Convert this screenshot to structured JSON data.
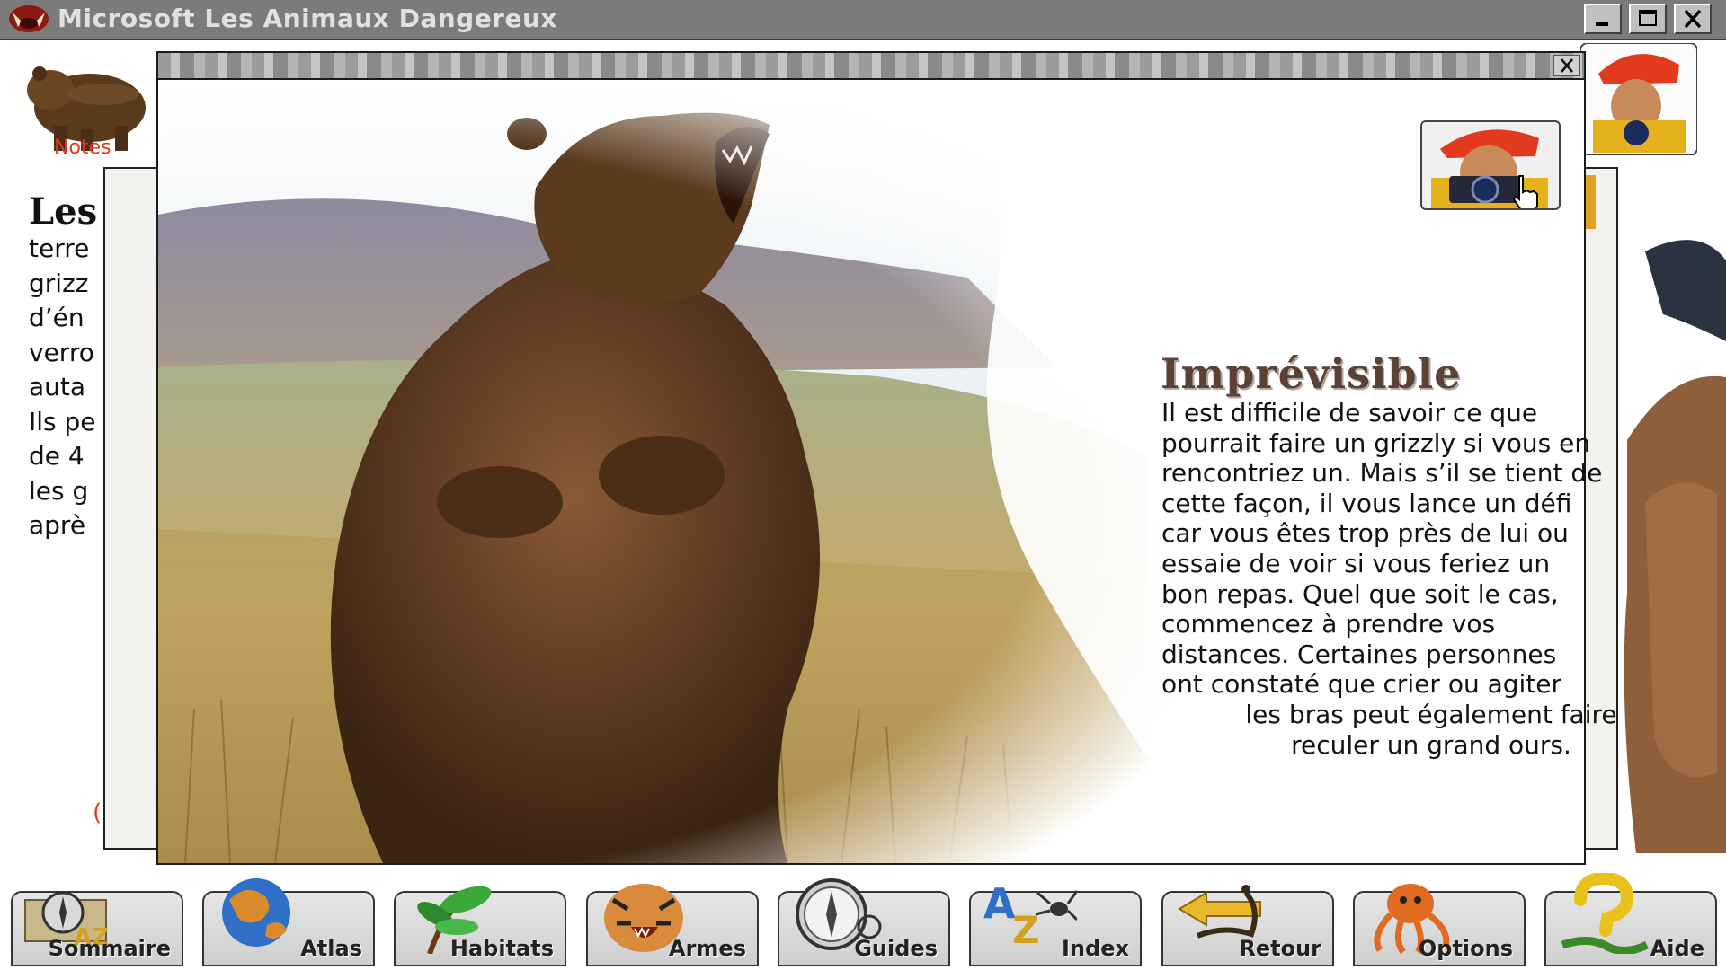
{
  "window": {
    "title": "Microsoft Les Animaux Dangereux",
    "controls": [
      "minimize",
      "maximize",
      "close"
    ]
  },
  "background_page": {
    "notes_label": "Notes",
    "heading": "Les",
    "lines": [
      "terre",
      "grizz",
      "d’én",
      "verro",
      "auta",
      "Ils pe",
      "de 4",
      "les g",
      "aprè"
    ],
    "red_mark": "("
  },
  "popup": {
    "title": "Imprévisible",
    "text_lines": [
      "Il est difficile de savoir ce que",
      "pourrait faire un grizzly si vous en",
      "rencontriez un. Mais s’il se tient de",
      "cette façon, il vous lance un défi",
      "car vous êtes trop près de lui ou",
      "essaie de voir si vous feriez un",
      "bon repas. Quel que soit le cas,",
      "commencez à prendre vos",
      "distances. Certaines personnes",
      "ont constaté que crier ou agiter",
      "les bras peut également faire",
      "reculer un grand ours."
    ],
    "image_subject": "grizzly bear standing in grass",
    "camera_button_icon": "photographer-icon",
    "cursor": "hand-pointer-icon"
  },
  "toolbar": {
    "buttons": [
      {
        "label": "Sommaire",
        "icon": "compass-map-icon"
      },
      {
        "label": "Atlas",
        "icon": "globe-icon"
      },
      {
        "label": "Habitats",
        "icon": "plant-icon"
      },
      {
        "label": "Armes",
        "icon": "tiger-icon"
      },
      {
        "label": "Guides",
        "icon": "compass-icon"
      },
      {
        "label": "Index",
        "icon": "az-spider-icon"
      },
      {
        "label": "Retour",
        "icon": "scorpion-arrow-icon"
      },
      {
        "label": "Options",
        "icon": "octopus-icon"
      },
      {
        "label": "Aide",
        "icon": "question-snake-icon"
      }
    ]
  },
  "colors": {
    "titlebar": "#7b7b7b",
    "accent_red": "#e03a1e",
    "popup_title": "#5a4236"
  }
}
